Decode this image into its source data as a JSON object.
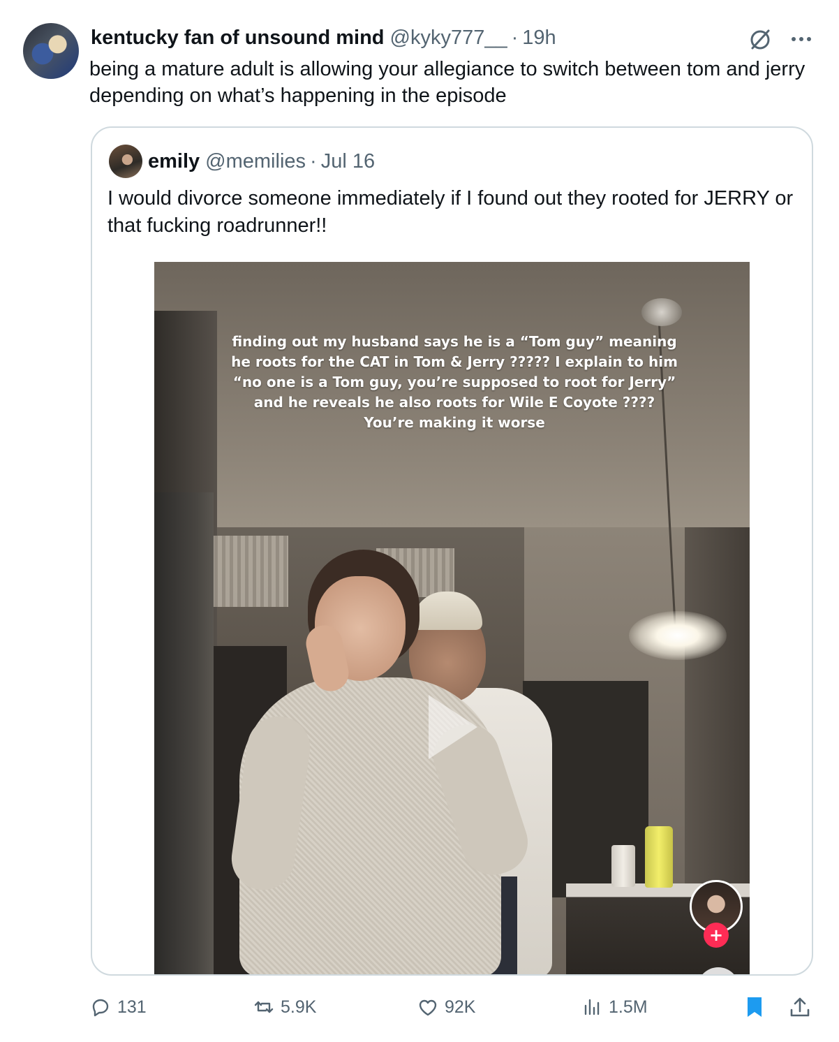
{
  "tweet": {
    "author": {
      "display_name": "kentucky fan of unsound mind",
      "handle": "@kyky777__",
      "time": "19h"
    },
    "separator": "·",
    "text": "being a mature adult is allowing your allegiance to switch between tom and jerry depending on what’s happening in the episode",
    "icons": {
      "grok": "grok-icon",
      "more": "more-icon"
    }
  },
  "quote": {
    "author": {
      "display_name": "emily",
      "handle": "@memilies",
      "time": "Jul 16"
    },
    "separator": "·",
    "text": "I would divorce someone immediately if I found out they rooted for JERRY or that fucking roadrunner!!",
    "video": {
      "caption": "finding out my husband says he is a “Tom guy” meaning he roots for the CAT in Tom & Jerry ????? I explain to him “no one is a Tom guy, you’re supposed to root for Jerry” and he reveals he also roots for Wile E Coyote ???? You’re making it worse",
      "follow_plus": "+"
    }
  },
  "actions": {
    "replies": "131",
    "reposts": "5.9K",
    "likes": "92K",
    "views": "1.5M",
    "accent_color": "#1d9bf0",
    "muted_color": "#536471"
  }
}
